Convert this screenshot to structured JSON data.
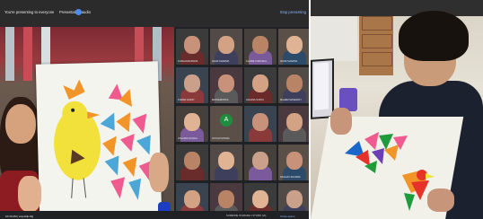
{
  "call": {
    "presenting_label": "You're presenting to everyone",
    "presentation_audio_label": "Presentation audio",
    "stop_presenting_label": "Stop presenting",
    "participants": [
      {
        "name": "KUSHAGRA BANS"
      },
      {
        "name": "AVANI SHARMA"
      },
      {
        "name": "CLAIRE THIRUMAL"
      },
      {
        "name": "AVANI SHARMA"
      },
      {
        "name": "KUMAR ANANT"
      },
      {
        "name": "MATHEMATICS"
      },
      {
        "name": "AAHANA SURYA"
      },
      {
        "name": "MAHEM MASERATI"
      },
      {
        "name": "ATHARVA SANGH"
      },
      {
        "name": "AYUSHI SITANG"
      },
      {
        "name": ""
      },
      {
        "name": ""
      },
      {
        "name": ""
      },
      {
        "name": ""
      },
      {
        "name": ""
      },
      {
        "name": "RAGHAV SHARMA"
      },
      {
        "name": ""
      },
      {
        "name": ""
      },
      {
        "name": ""
      },
      {
        "name": ""
      }
    ],
    "avatar_letter": "A",
    "meeting_id": "10:43 AM | ewj-dvjk-bfg",
    "bottom_caption": "SOMEONE IN GRADE 1 STUDIO (sb)",
    "close_label": "Close space"
  },
  "colors": {
    "bird_yellow": "#f1e13a",
    "triangle_blue": "#4ba7d8",
    "triangle_pink": "#ef5a8f",
    "triangle_orange": "#f39428",
    "photo_bird_red": "#e5332a",
    "photo_bird_green": "#1f9b3b"
  }
}
